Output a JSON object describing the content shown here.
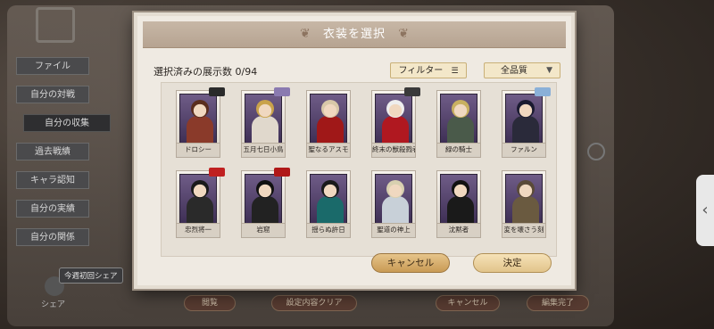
{
  "background": {
    "menu": [
      "ファイル",
      "自分の対戦",
      "自分の収集",
      "過去戦績",
      "キャラ認知",
      "自分の実績",
      "自分の関係"
    ],
    "active_index": 2,
    "share_bubble": "今週初回シェア",
    "share_label": "シェア",
    "bottom_buttons": [
      "閲覧",
      "設定内容クリア",
      "キャンセル",
      "編集完了"
    ]
  },
  "dialog": {
    "title": "衣装を選択",
    "count_label": "選択済みの展示数 0/94",
    "filter_label": "フィルター",
    "quality_label": "全品質",
    "cancel_label": "キャンセル",
    "ok_label": "決定"
  },
  "costumes": [
    {
      "name": "ドロシー",
      "hair": "#5a2e1e",
      "outfit": "#8a3a2a",
      "tag": "#2a2a2a"
    },
    {
      "name": "五月七日小鳥",
      "hair": "#c9a24a",
      "outfit": "#e0d8cc",
      "tag": "#8a7ab0"
    },
    {
      "name": "聖なるアスモ",
      "hair": "#d8c8a8",
      "outfit": "#a01818",
      "tag": ""
    },
    {
      "name": "終末の獣殺戮者",
      "hair": "#eeeeee",
      "outfit": "#b01820",
      "tag": "#3a3a3a"
    },
    {
      "name": "緑の騎士",
      "hair": "#c8b060",
      "outfit": "#4a5a4a",
      "tag": ""
    },
    {
      "name": "ファルン",
      "hair": "#1a1a30",
      "outfit": "#2a2a3a",
      "tag": "#8ab0d8"
    },
    {
      "name": "忠烈将一",
      "hair": "#1a1a1a",
      "outfit": "#2a2a2a",
      "tag": "#c02020"
    },
    {
      "name": "岩窟",
      "hair": "#111111",
      "outfit": "#222222",
      "tag": "#b01818"
    },
    {
      "name": "揺らぬ許日",
      "hair": "#1a1a1a",
      "outfit": "#1a6a6a",
      "tag": ""
    },
    {
      "name": "聖道の神上",
      "hair": "#d8d0b0",
      "outfit": "#c8d0d8",
      "tag": ""
    },
    {
      "name": "沈黙者",
      "hair": "#111111",
      "outfit": "#1a1a1a",
      "tag": ""
    },
    {
      "name": "変を壊さう刻",
      "hair": "#5a4a38",
      "outfit": "#6a5a40",
      "tag": ""
    }
  ],
  "icons": {
    "filter": "list-icon",
    "chevron": "chevron-down-icon",
    "handle": "chevron-left-icon"
  }
}
